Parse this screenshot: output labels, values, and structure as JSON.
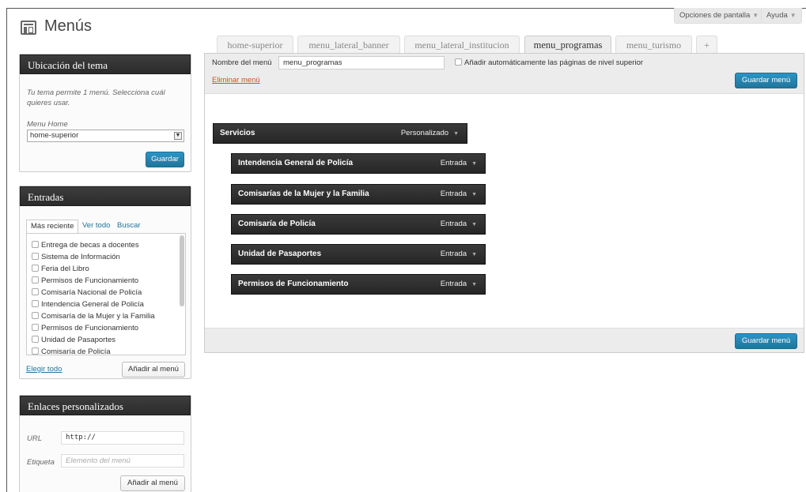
{
  "screen_options": {
    "label": "Opciones de pantalla"
  },
  "help": {
    "label": "Ayuda"
  },
  "page_title": "Menús",
  "theme_location": {
    "title": "Ubicación del tema",
    "note": "Tu tema permite 1 menú. Selecciona cuál quieres usar.",
    "field_label": "Menu Home",
    "selected": "home-superior",
    "save_label": "Guardar"
  },
  "entries": {
    "title": "Entradas",
    "tabs": [
      "Más reciente",
      "Ver todo",
      "Buscar"
    ],
    "items": [
      "Entrega de becas a docentes",
      "Sistema de Información",
      "Feria del Libro",
      "Permisos de Funcionamiento",
      "Comisaría Nacional de Policía",
      "Intendencia General de Policía",
      "Comisaría de la Mujer y la Familia",
      "Permisos de Funcionamiento",
      "Unidad de Pasaportes",
      "Comisaría de Policía"
    ],
    "select_all": "Elegir todo",
    "add_label": "Añadir al menú"
  },
  "custom_links": {
    "title": "Enlaces personalizados",
    "url_label": "URL",
    "url_value": "http://",
    "label_label": "Etiqueta",
    "label_placeholder": "Elemento del menú",
    "add_label": "Añadir al menú"
  },
  "menu_tabs": [
    "home-superior",
    "menu_lateral_banner",
    "menu_lateral_institucion",
    "menu_programas",
    "menu_turismo",
    "+"
  ],
  "active_tab": "menu_programas",
  "editor": {
    "name_label": "Nombre del menú",
    "name_value": "menu_programas",
    "auto_add_label": "Añadir automáticamente las páginas de nivel superior",
    "delete_label": "Eliminar menú",
    "save_label": "Guardar menú"
  },
  "menu_items": [
    {
      "title": "Servicios",
      "type": "Personalizado",
      "depth": 0
    },
    {
      "title": "Intendencia General de Policía",
      "type": "Entrada",
      "depth": 1
    },
    {
      "title": "Comisarías de la Mujer y la Familia",
      "type": "Entrada",
      "depth": 1
    },
    {
      "title": "Comisaría de Policía",
      "type": "Entrada",
      "depth": 1
    },
    {
      "title": "Unidad de Pasaportes",
      "type": "Entrada",
      "depth": 1
    },
    {
      "title": "Permisos de Funcionamiento",
      "type": "Entrada",
      "depth": 1
    }
  ],
  "colors": {
    "primary_button": "#21759b",
    "box_header": "#333333",
    "delete_link": "#d54e21"
  }
}
